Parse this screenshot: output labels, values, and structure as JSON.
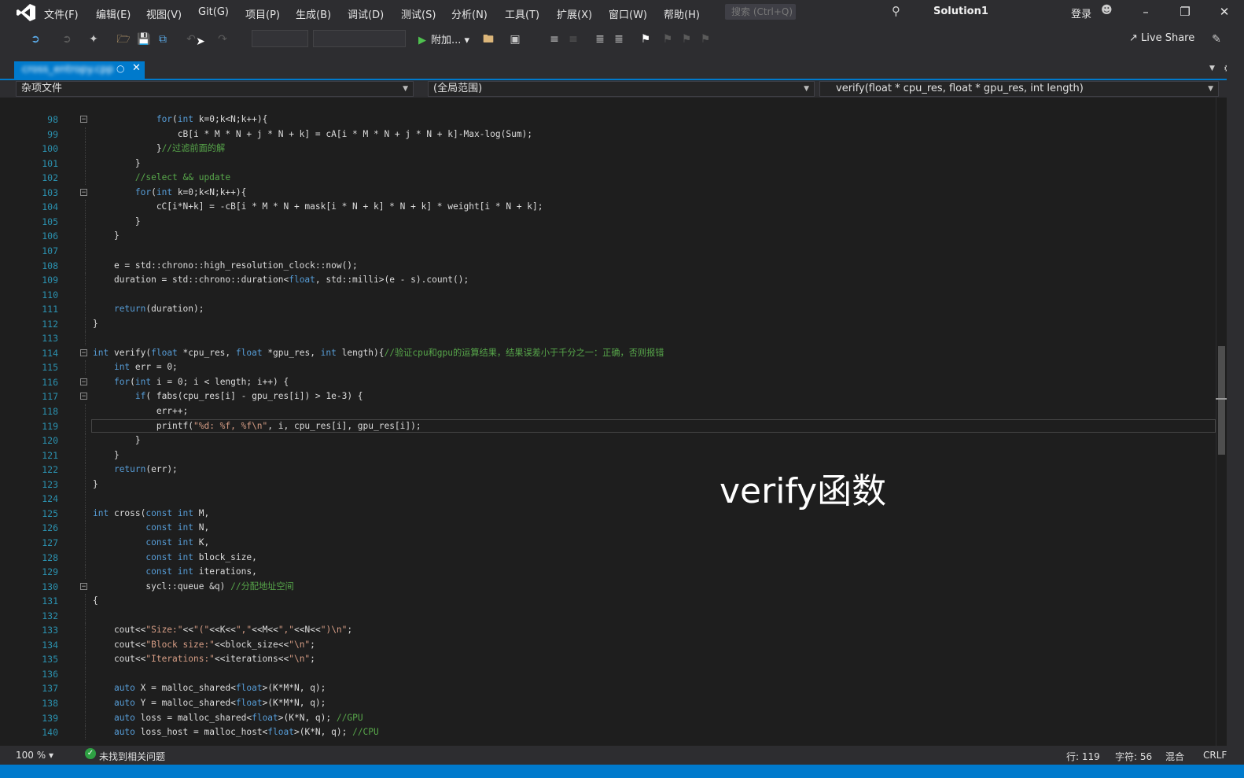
{
  "menubar": {
    "items": [
      "文件(F)",
      "编辑(E)",
      "视图(V)",
      "Git(G)",
      "项目(P)",
      "生成(B)",
      "调试(D)",
      "测试(S)",
      "分析(N)",
      "工具(T)",
      "扩展(X)",
      "窗口(W)",
      "帮助(H)"
    ],
    "search_placeholder": "搜索 (Ctrl+Q)",
    "solution_title": "Solution1",
    "login_label": "登录"
  },
  "toolbar": {
    "attach_label": "附加...",
    "liveshare_label": "Live Share"
  },
  "tab": {
    "filename": "cross_entropy.cpp"
  },
  "navbar": {
    "project": "杂项文件",
    "scope": "(全局范围)",
    "member": "verify(float * cpu_res, float * gpu_res, int length)"
  },
  "code_lines": [
    {
      "n": "98",
      "t": "            for(int k=0;k<N;k++){"
    },
    {
      "n": "99",
      "t": "                cB[i * M * N + j * N + k] = cA[i * M * N + j * N + k]-Max-log(Sum);"
    },
    {
      "n": "100",
      "t": "            }//过滤前面的解"
    },
    {
      "n": "101",
      "t": "        }"
    },
    {
      "n": "102",
      "t": "        //select && update"
    },
    {
      "n": "103",
      "t": "        for(int k=0;k<N;k++){"
    },
    {
      "n": "104",
      "t": "            cC[i*N+k] = -cB[i * M * N + mask[i * N + k] * N + k] * weight[i * N + k];"
    },
    {
      "n": "105",
      "t": "        }"
    },
    {
      "n": "106",
      "t": "    }"
    },
    {
      "n": "107",
      "t": ""
    },
    {
      "n": "108",
      "t": "    e = std::chrono::high_resolution_clock::now();"
    },
    {
      "n": "109",
      "t": "    duration = std::chrono::duration<float, std::milli>(e - s).count();"
    },
    {
      "n": "110",
      "t": ""
    },
    {
      "n": "111",
      "t": "    return(duration);"
    },
    {
      "n": "112",
      "t": "}"
    },
    {
      "n": "113",
      "t": ""
    },
    {
      "n": "114",
      "t": "int verify(float *cpu_res, float *gpu_res, int length){//验证cpu和gpu的运算结果，结果误差小于千分之一：正确，否则报错"
    },
    {
      "n": "115",
      "t": "    int err = 0;"
    },
    {
      "n": "116",
      "t": "    for(int i = 0; i < length; i++) {"
    },
    {
      "n": "117",
      "t": "        if( fabs(cpu_res[i] - gpu_res[i]) > 1e-3) {"
    },
    {
      "n": "118",
      "t": "            err++;"
    },
    {
      "n": "119",
      "t": "            printf(\"%d: %f, %f\\n\", i, cpu_res[i], gpu_res[i]);"
    },
    {
      "n": "120",
      "t": "        }"
    },
    {
      "n": "121",
      "t": "    }"
    },
    {
      "n": "122",
      "t": "    return(err);"
    },
    {
      "n": "123",
      "t": "}"
    },
    {
      "n": "124",
      "t": ""
    },
    {
      "n": "125",
      "t": "int cross(const int M,"
    },
    {
      "n": "126",
      "t": "          const int N,"
    },
    {
      "n": "127",
      "t": "          const int K,"
    },
    {
      "n": "128",
      "t": "          const int block_size,"
    },
    {
      "n": "129",
      "t": "          const int iterations,"
    },
    {
      "n": "130",
      "t": "          sycl::queue &q) //分配地址空间"
    },
    {
      "n": "131",
      "t": "{"
    },
    {
      "n": "132",
      "t": ""
    },
    {
      "n": "133",
      "t": "    cout<<\"Size:\"<<\"(\"<<K<<\",\"<<M<<\",\"<<N<<\")\\n\";"
    },
    {
      "n": "134",
      "t": "    cout<<\"Block size:\"<<block_size<<\"\\n\";"
    },
    {
      "n": "135",
      "t": "    cout<<\"Iterations:\"<<iterations<<\"\\n\";"
    },
    {
      "n": "136",
      "t": ""
    },
    {
      "n": "137",
      "t": "    auto X = malloc_shared<float>(K*M*N, q);"
    },
    {
      "n": "138",
      "t": "    auto Y = malloc_shared<float>(K*M*N, q);"
    },
    {
      "n": "139",
      "t": "    auto loss = malloc_shared<float>(K*N, q); //GPU"
    },
    {
      "n": "140",
      "t": "    auto loss_host = malloc_host<float>(K*N, q); //CPU"
    }
  ],
  "overlay_caption": "verify函数",
  "status": {
    "zoom": "100 %",
    "issues": "未找到相关问题",
    "line": "行: 119",
    "column": "字符: 56",
    "mixed": "混合",
    "line_ending": "CRLF"
  },
  "colors": {
    "accent": "#007acc",
    "keyword": "#569cd6",
    "comment": "#57a64a",
    "line_number": "#2b91af",
    "background": "#1e1e1e"
  }
}
